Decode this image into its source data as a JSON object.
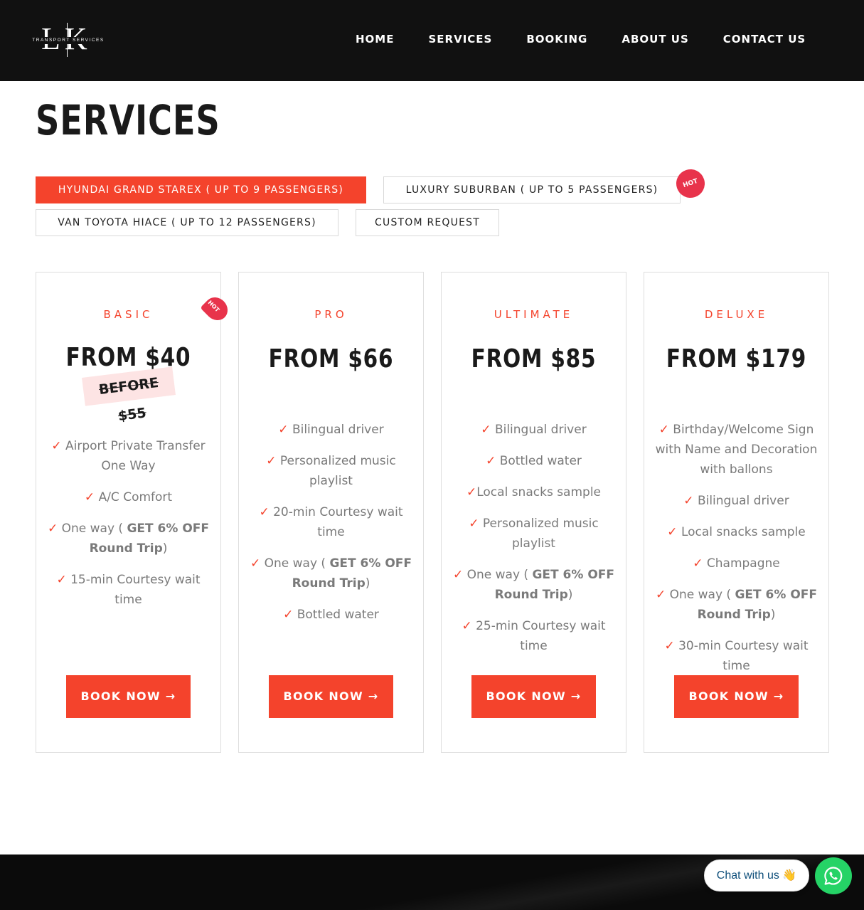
{
  "header": {
    "logo": {
      "letters": "LK",
      "subtitle": "TRANSPORT SERVICES"
    },
    "nav": [
      "HOME",
      "SERVICES",
      "BOOKING",
      "ABOUT US",
      "CONTACT US"
    ]
  },
  "page_title": "SERVICES",
  "tabs": [
    {
      "label": "HYUNDAI GRAND STAREX ( UP TO 9 PASSENGERS)",
      "active": true
    },
    {
      "label": "LUXURY SUBURBAN ( UP TO 5 PASSENGERS)",
      "active": false
    },
    {
      "label": "VAN TOYOTA HIACE ( UP TO 12 PASSENGERS)",
      "active": false
    },
    {
      "label": "CUSTOM REQUEST",
      "active": false
    }
  ],
  "hot_badge": "HOT",
  "cards": [
    {
      "tier": "BASIC",
      "price": "FROM $40",
      "before": "BEFORE $55",
      "hot": "HOT",
      "features": [
        "Airport Private Transfer One Way",
        "A/C Comfort",
        "One way (",
        "GET 6% OFF Round Trip",
        ")",
        "15-min Courtesy wait time"
      ],
      "book": "BOOK NOW →"
    },
    {
      "tier": "PRO",
      "price": "FROM $66",
      "features": [
        "Bilingual driver",
        "Personalized music playlist",
        "20-min Courtesy wait time",
        "One way (",
        "GET 6% OFF Round Trip",
        ")",
        "Bottled water"
      ],
      "book": "BOOK NOW →"
    },
    {
      "tier": "ULTIMATE",
      "price": "FROM $85",
      "features": [
        "Bilingual driver",
        "Bottled water",
        "Local snacks sample",
        "Personalized music playlist",
        "One way (",
        "GET 6% OFF Round Trip",
        ")",
        "25-min Courtesy wait time"
      ],
      "book": "BOOK NOW →"
    },
    {
      "tier": "DELUXE",
      "price": "FROM $179",
      "features": [
        "Birthday/Welcome Sign with Name and Decoration with ballons",
        "Bilingual driver",
        "Local snacks sample",
        "Champagne",
        "One way (",
        "GET 6% OFF Round Trip",
        ")",
        "30-min Courtesy wait time"
      ],
      "book": "BOOK NOW →"
    }
  ],
  "check": "✓",
  "chat": {
    "label": "Chat with us 👋"
  },
  "colors": {
    "accent": "#f4432c",
    "header_bg": "#111111",
    "hot_badge": "#e8334b",
    "whatsapp": "#25d366"
  }
}
